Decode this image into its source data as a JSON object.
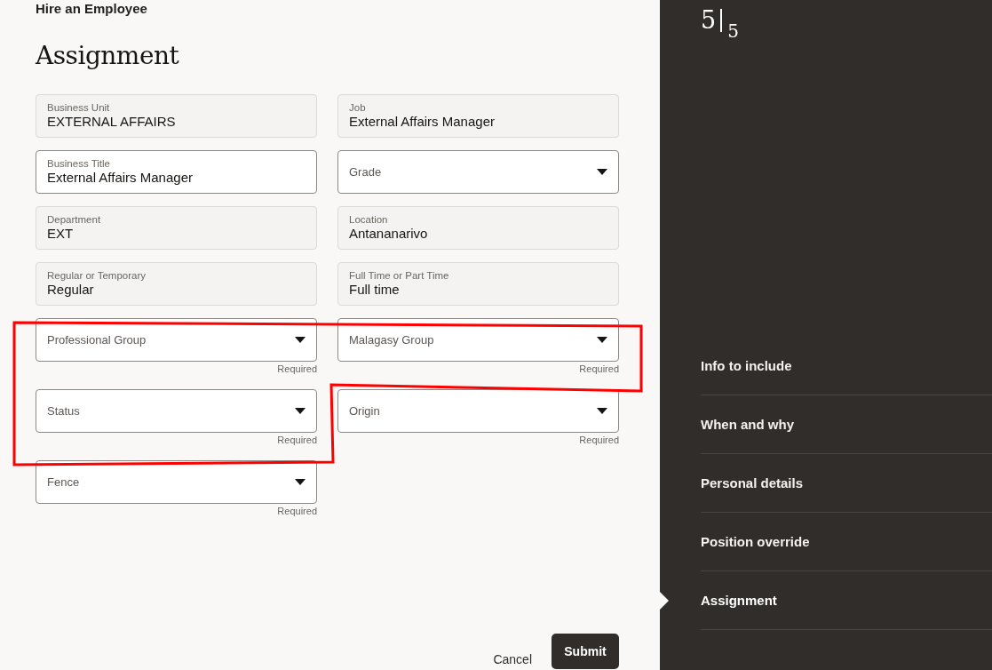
{
  "header": {
    "breadcrumb": "Hire an Employee",
    "title": "Assignment"
  },
  "fields": [
    {
      "kind": "readonly",
      "label": "Business Unit",
      "value": "EXTERNAL AFFAIRS"
    },
    {
      "kind": "readonly",
      "label": "Job",
      "value": "External Affairs Manager"
    },
    {
      "kind": "text",
      "label": "Business Title",
      "value": "External Affairs Manager"
    },
    {
      "kind": "select",
      "label": "Grade"
    },
    {
      "kind": "readonly",
      "label": "Department",
      "value": "EXT"
    },
    {
      "kind": "readonly",
      "label": "Location",
      "value": "Antananarivo"
    },
    {
      "kind": "readonly",
      "label": "Regular or Temporary",
      "value": "Regular"
    },
    {
      "kind": "readonly",
      "label": "Full Time or Part Time",
      "value": "Full time"
    },
    {
      "kind": "select",
      "label": "Professional Group",
      "helper": "Required"
    },
    {
      "kind": "select",
      "label": "Malagasy Group",
      "helper": "Required"
    },
    {
      "kind": "select",
      "label": "Status",
      "helper": "Required"
    },
    {
      "kind": "select",
      "label": "Origin",
      "helper": "Required"
    },
    {
      "kind": "select",
      "label": "Fence",
      "helper": "Required"
    }
  ],
  "actions": {
    "cancel": "Cancel",
    "submit": "Submit"
  },
  "progress": {
    "current": "5",
    "total": "5"
  },
  "steps": [
    {
      "label": "Info to include",
      "selected": false
    },
    {
      "label": "When and why",
      "selected": false
    },
    {
      "label": "Personal details",
      "selected": false
    },
    {
      "label": "Position override",
      "selected": false
    },
    {
      "label": "Assignment",
      "selected": true
    }
  ]
}
